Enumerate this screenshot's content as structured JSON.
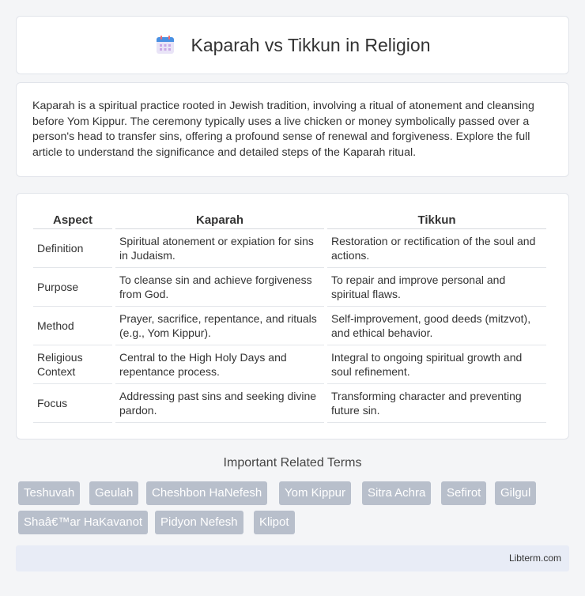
{
  "header": {
    "title": "Kaparah vs Tikkun in Religion",
    "icon": "calendar-icon"
  },
  "intro": {
    "text": "Kaparah is a spiritual practice rooted in Jewish tradition, involving a ritual of atonement and cleansing before Yom Kippur. The ceremony typically uses a live chicken or money symbolically passed over a person's head to transfer sins, offering a profound sense of renewal and forgiveness. Explore the full article to understand the significance and detailed steps of the Kaparah ritual."
  },
  "table": {
    "headers": [
      "Aspect",
      "Kaparah",
      "Tikkun"
    ],
    "rows": [
      [
        "Definition",
        "Spiritual atonement or expiation for sins in Judaism.",
        "Restoration or rectification of the soul and actions."
      ],
      [
        "Purpose",
        "To cleanse sin and achieve forgiveness from God.",
        "To repair and improve personal and spiritual flaws."
      ],
      [
        "Method",
        "Prayer, sacrifice, repentance, and rituals (e.g., Yom Kippur).",
        "Self-improvement, good deeds (mitzvot), and ethical behavior."
      ],
      [
        "Religious Context",
        "Central to the High Holy Days and repentance process.",
        "Integral to ongoing spiritual growth and soul refinement."
      ],
      [
        "Focus",
        "Addressing past sins and seeking divine pardon.",
        "Transforming character and preventing future sin."
      ]
    ]
  },
  "related": {
    "title": "Important Related Terms",
    "tags": [
      "Teshuvah",
      "Geulah",
      "Cheshbon HaNefesh",
      "Yom Kippur",
      "Sitra Achra",
      "Sefirot",
      "Gilgul",
      "Shaâ€™ar HaKavanot",
      "Pidyon Nefesh",
      "Klipot"
    ]
  },
  "footer": {
    "site": "Libterm.com"
  }
}
